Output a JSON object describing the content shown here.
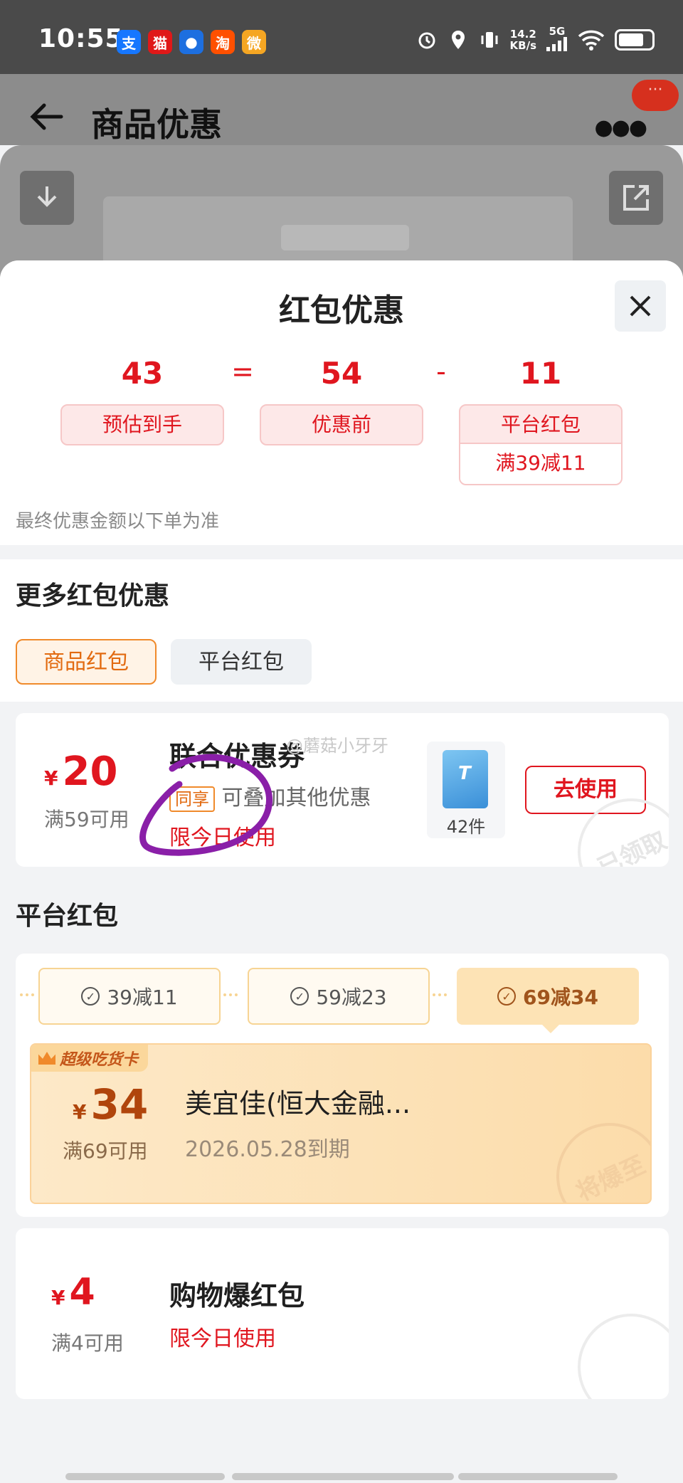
{
  "status_bar": {
    "time": "10:55",
    "apps": [
      {
        "name": "alipay-icon",
        "glyph": "支",
        "color": "#1677ff"
      },
      {
        "name": "tmall-icon",
        "glyph": "猫",
        "color": "#e01818"
      },
      {
        "name": "app-blue-icon",
        "glyph": "●",
        "color": "#1d6fe0"
      },
      {
        "name": "taobao-icon",
        "glyph": "淘",
        "color": "#ff5000"
      },
      {
        "name": "weibo-icon",
        "glyph": "微",
        "color": "#f5a623"
      }
    ],
    "net_speed": "14.2",
    "net_unit": "KB/s",
    "network": "5G"
  },
  "page": {
    "title": "商品优惠"
  },
  "sheet": {
    "title": "红包优惠",
    "equation": {
      "final": "43",
      "eq": "=",
      "before": "54",
      "minus": "-",
      "discount": "11",
      "final_label": "预估到手",
      "before_label": "优惠前",
      "discount_label": "平台红包",
      "discount_detail": "满39减11"
    },
    "note": "最终优惠金额以下单为准"
  },
  "more": {
    "title": "更多红包优惠",
    "tabs": [
      "商品红包",
      "平台红包"
    ],
    "active_tab": 0
  },
  "joint_coupon": {
    "yen": "¥",
    "amount": "20",
    "condition": "满59可用",
    "title": "联合优惠券",
    "tag": "同享",
    "tag_desc": "可叠加其他优惠",
    "limit": "限今日使用",
    "product_count": "42件",
    "button": "去使用",
    "stamp": "已领取",
    "watermark": "@蘑菇小牙牙"
  },
  "platform": {
    "title": "平台红包",
    "tiers": [
      "39减11",
      "59减23",
      "69减34"
    ],
    "active_tier": 2,
    "super_badge": "超级吃货卡",
    "coupon": {
      "yen": "¥",
      "amount": "34",
      "condition": "满69可用",
      "title": "美宜佳(恒大金融...",
      "expiry": "2026.05.28到期",
      "stamp": "将爆至"
    }
  },
  "baozhi": {
    "yen": "¥",
    "amount": "4",
    "condition": "满4可用",
    "title": "购物爆红包",
    "limit": "限今日使用"
  },
  "colors": {
    "accent_red": "#e0161f",
    "accent_orange": "#f08a2b",
    "annotation_purple": "#8a1fa8"
  }
}
